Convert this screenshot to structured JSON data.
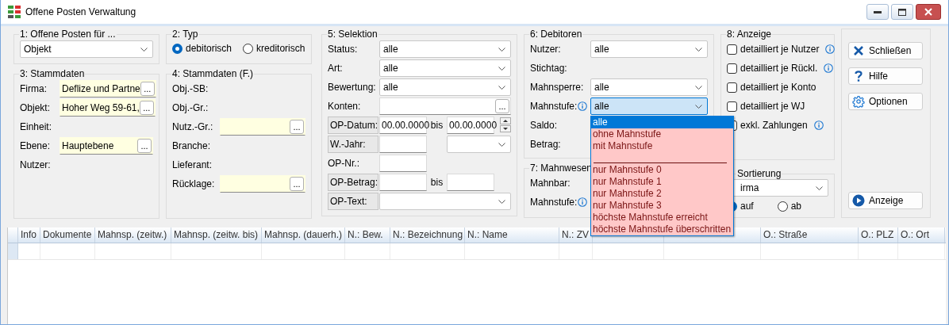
{
  "window": {
    "title": "Offene Posten Verwaltung"
  },
  "filter_for": {
    "title": "1: Offene Posten für ...",
    "combo": {
      "value": "Objekt"
    }
  },
  "type": {
    "title": "2: Typ",
    "radios": [
      {
        "label": "debitorisch",
        "selected": true
      },
      {
        "label": "kreditorisch",
        "selected": false
      }
    ]
  },
  "master_data": {
    "title": "3: Stammdaten",
    "rows": [
      {
        "label": "Firma:",
        "controls": [
          {
            "kind": "lookup",
            "value": "Deflize und Partne",
            "button": "..."
          }
        ]
      },
      {
        "label": "Objekt:",
        "controls": [
          {
            "kind": "lookup",
            "value": "Hoher Weg 59-61,",
            "button": "..."
          }
        ]
      },
      {
        "label": "Einheit:"
      },
      {
        "label": "Ebene:",
        "controls": [
          {
            "kind": "lookup",
            "value": "Hauptebene",
            "button": "..."
          }
        ]
      },
      {
        "label": "Nutzer:"
      }
    ]
  },
  "master_data_f": {
    "title": "4: Stammdaten (F.)",
    "rows": [
      {
        "label": "Obj.-SB:"
      },
      {
        "label": "Obj.-Gr.:"
      },
      {
        "label": "Nutz.-Gr.:",
        "controls": [
          {
            "kind": "lookup",
            "button": "..."
          }
        ]
      },
      {
        "label": "Branche:"
      },
      {
        "label": "Lieferant:"
      },
      {
        "label": "Rücklage:",
        "controls": [
          {
            "kind": "lookup",
            "button": "..."
          }
        ]
      }
    ]
  },
  "selection": {
    "title": "5: Selektion",
    "rows": [
      {
        "label": "Status:",
        "label_button": false,
        "controls": [
          {
            "kind": "combo",
            "value": "alle"
          }
        ]
      },
      {
        "label": "Art:",
        "label_button": false,
        "controls": [
          {
            "kind": "combo",
            "value": "alle"
          }
        ]
      },
      {
        "label": "Bewertung:",
        "label_button": false,
        "controls": [
          {
            "kind": "combo",
            "value": "alle"
          }
        ]
      },
      {
        "label": "Konten:",
        "label_button": false,
        "controls": [
          {
            "kind": "picker",
            "button": "..."
          }
        ]
      },
      {
        "label": "OP-Datum:",
        "label_button": true,
        "controls": [
          {
            "kind": "field",
            "value": "00.00.0000"
          },
          {
            "kind": "text",
            "text": "bis"
          },
          {
            "kind": "field",
            "value": "00.00.0000"
          },
          {
            "kind": "spinner"
          }
        ]
      },
      {
        "label": "W.-Jahr:",
        "label_button": true,
        "controls": [
          {
            "kind": "field"
          },
          {
            "kind": "combo"
          }
        ]
      },
      {
        "label": "OP-Nr.:",
        "label_button": false,
        "controls": [
          {
            "kind": "field"
          }
        ]
      },
      {
        "label": "OP-Betrag:",
        "label_button": true,
        "controls": [
          {
            "kind": "field"
          },
          {
            "kind": "text",
            "text": "bis"
          },
          {
            "kind": "field"
          }
        ]
      },
      {
        "label": "OP-Text:",
        "label_button": true,
        "controls": [
          {
            "kind": "combo"
          }
        ]
      }
    ]
  },
  "debtors": {
    "title": "6: Debitoren",
    "rows": [
      {
        "label": "Nutzer:",
        "info": false,
        "controls": [
          {
            "kind": "combo",
            "value": "alle"
          }
        ]
      },
      {
        "label": "Stichtag:",
        "info": false
      },
      {
        "label": "Mahnsperre:",
        "info": false,
        "controls": [
          {
            "kind": "combo",
            "value": "alle"
          }
        ]
      },
      {
        "label": "Mahnstufe:",
        "info": true,
        "controls": [
          {
            "kind": "combo",
            "value": "alle",
            "open": true,
            "options": [
              {
                "kind": "option",
                "label": "alle",
                "selected": true
              },
              {
                "kind": "option",
                "label": "ohne Mahnstufe",
                "selected": false
              },
              {
                "kind": "option",
                "label": "mit Mahnstufe",
                "selected": false
              },
              {
                "kind": "separator"
              },
              {
                "kind": "option",
                "label": "nur Mahnstufe 0",
                "selected": false
              },
              {
                "kind": "option",
                "label": "nur Mahnstufe 1",
                "selected": false
              },
              {
                "kind": "option",
                "label": "nur Mahnstufe 2",
                "selected": false
              },
              {
                "kind": "option",
                "label": "nur Mahnstufe 3",
                "selected": false
              },
              {
                "kind": "option",
                "label": "höchste Mahnstufe erreicht",
                "selected": false
              },
              {
                "kind": "option",
                "label": "höchste Mahnstufe überschritten",
                "selected": false
              }
            ]
          }
        ]
      },
      {
        "label": "Saldo:",
        "info": false
      },
      {
        "label": "Betrag:",
        "info": false
      }
    ]
  },
  "dunning": {
    "title": "7: Mahnwesen",
    "rows": [
      {
        "label": "Mahnbar:",
        "info": false
      },
      {
        "label": "Mahnstufe:",
        "info": true
      }
    ]
  },
  "display": {
    "title": "8: Anzeige",
    "checks": [
      {
        "label": "detailliert je Nutzer",
        "checked": false,
        "info": true
      },
      {
        "label": "detailliert je Rückl.",
        "checked": false,
        "info": true
      },
      {
        "label": "detailliert je Konto",
        "checked": false,
        "info": false
      },
      {
        "label": "detailliert je WJ",
        "checked": false,
        "info": false
      },
      {
        "label": "exkl. Zahlungen",
        "checked": false,
        "info": true
      }
    ]
  },
  "sorting": {
    "title": "Sortierung",
    "combo": {
      "value": "irma"
    },
    "radios": [
      {
        "label": "auf",
        "selected": true
      },
      {
        "label": "ab",
        "selected": false
      }
    ]
  },
  "buttons": [
    {
      "kind": "close",
      "label": "Schließen"
    },
    {
      "kind": "help",
      "label": "Hilfe"
    },
    {
      "kind": "options",
      "label": "Optionen"
    },
    {
      "kind": "show",
      "label": "Anzeige"
    }
  ],
  "table": {
    "columns": [
      {
        "label": "Info"
      },
      {
        "label": "Dokumente"
      },
      {
        "label": "Mahnsp. (zeitw.)"
      },
      {
        "label": "Mahnsp. (zeitw. bis)"
      },
      {
        "label": "Mahnsp. (dauerh.)"
      },
      {
        "label": "N.: Bew."
      },
      {
        "label": "N.: Bezeichnung"
      },
      {
        "label": "N.: Name"
      },
      {
        "label": "N.: ZV"
      },
      {},
      {},
      {
        "label": "O.: Straße"
      },
      {
        "label": "O.: PLZ"
      },
      {
        "label": "O.: Ort"
      }
    ]
  }
}
